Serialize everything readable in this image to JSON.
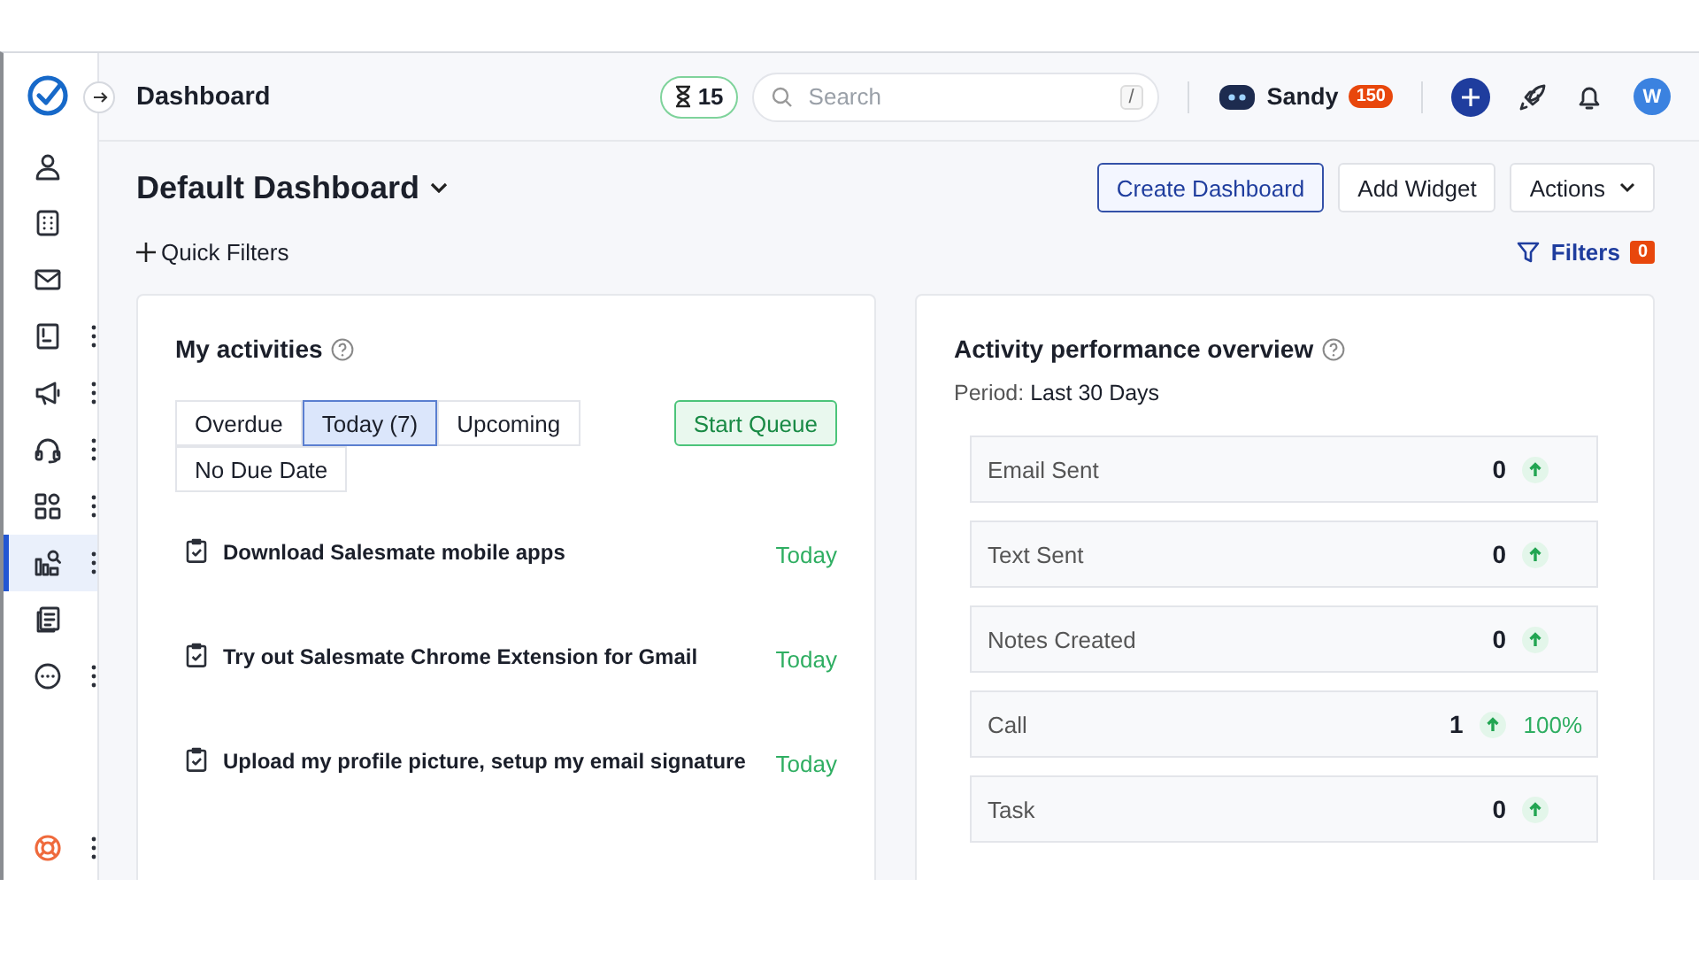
{
  "header": {
    "title": "Dashboard",
    "timer_count": "15",
    "search": {
      "placeholder": "Search",
      "shortcut": "/"
    },
    "user": {
      "name": "Sandy",
      "badge": "150"
    },
    "avatar_initial": "W"
  },
  "sidebar": {
    "items": [
      {
        "kind": "person",
        "selected": false,
        "menu": false
      },
      {
        "kind": "building",
        "selected": false,
        "menu": false
      },
      {
        "kind": "mail",
        "selected": false,
        "menu": false
      },
      {
        "kind": "contact",
        "selected": false,
        "menu": true
      },
      {
        "kind": "megaphone",
        "selected": false,
        "menu": true
      },
      {
        "kind": "headset",
        "selected": false,
        "menu": true
      },
      {
        "kind": "apps",
        "selected": false,
        "menu": true
      },
      {
        "kind": "reports",
        "selected": true,
        "menu": true
      },
      {
        "kind": "document",
        "selected": false,
        "menu": false
      },
      {
        "kind": "more",
        "selected": false,
        "menu": true
      }
    ],
    "footer": {
      "kind": "help",
      "menu": true
    }
  },
  "dashboard": {
    "title": "Default Dashboard",
    "buttons": [
      {
        "label": "Create Dashboard",
        "kind": "primary"
      },
      {
        "label": "Add Widget",
        "kind": "plain"
      },
      {
        "label": "Actions",
        "kind": "dropdown"
      }
    ],
    "quick_filters": "Quick Filters",
    "filters": {
      "label": "Filters",
      "count": "0"
    }
  },
  "activities": {
    "title": "My activities",
    "tabs": [
      {
        "label": "Overdue",
        "selected": false
      },
      {
        "label": "Today (7)",
        "selected": true
      },
      {
        "label": "Upcoming",
        "selected": false
      },
      {
        "label": "No Due Date",
        "selected": false
      }
    ],
    "start_queue": "Start Queue",
    "items": [
      {
        "title": "Download Salesmate mobile apps",
        "due": "Today"
      },
      {
        "title": "Try out Salesmate Chrome Extension for Gmail",
        "due": "Today"
      },
      {
        "title": "Upload my profile picture, setup my email signature",
        "due": "Today"
      }
    ]
  },
  "performance": {
    "title": "Activity performance overview",
    "period_label": "Period:",
    "period_value": "Last 30 Days",
    "metrics": [
      {
        "label": "Email Sent",
        "value": "0"
      },
      {
        "label": "Text Sent",
        "value": "0"
      },
      {
        "label": "Notes Created",
        "value": "0"
      },
      {
        "label": "Call",
        "value": "1",
        "change": "100%"
      },
      {
        "label": "Task",
        "value": "0"
      }
    ]
  }
}
